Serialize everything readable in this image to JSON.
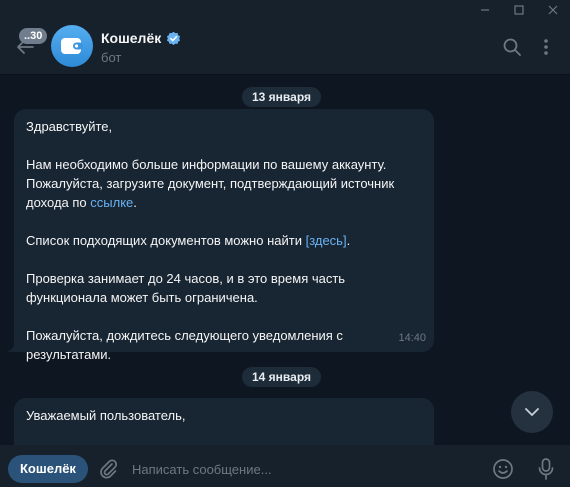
{
  "header": {
    "unread_count": "..30",
    "title": "Кошелёк",
    "subtitle": "бот"
  },
  "chat": {
    "dates": [
      "13 января",
      "14 января"
    ],
    "message1": {
      "lines": [
        "Здравствуйте,",
        "Нам необходимо больше информации по вашему аккаунту.",
        "Пожалуйста, загрузите документ, подтверждающий источник",
        "дохода по ",
        "ссылке",
        ".",
        "Список подходящих документов можно найти ",
        "[здесь]",
        ".",
        "Проверка занимает до 24 часов, и в это время часть",
        "функционала может быть ограничена.",
        "Пожалуйста, дождитесь следующего уведомления с",
        "результатами."
      ],
      "time": "14:40"
    },
    "message2": {
      "first_line": "Уважаемый пользователь,"
    }
  },
  "composer": {
    "bot_button": "Кошелёк",
    "placeholder": "Написать сообщение..."
  },
  "colors": {
    "background": "#0e1621",
    "panel": "#17212b",
    "bubble": "#182533",
    "accent": "#6ab3f3",
    "bot_button": "#2b5278"
  },
  "icons": [
    "back-arrow-icon",
    "wallet-icon",
    "verified-icon",
    "search-icon",
    "more-vertical-icon",
    "chevron-down-icon",
    "paperclip-icon",
    "emoji-icon",
    "microphone-icon"
  ]
}
